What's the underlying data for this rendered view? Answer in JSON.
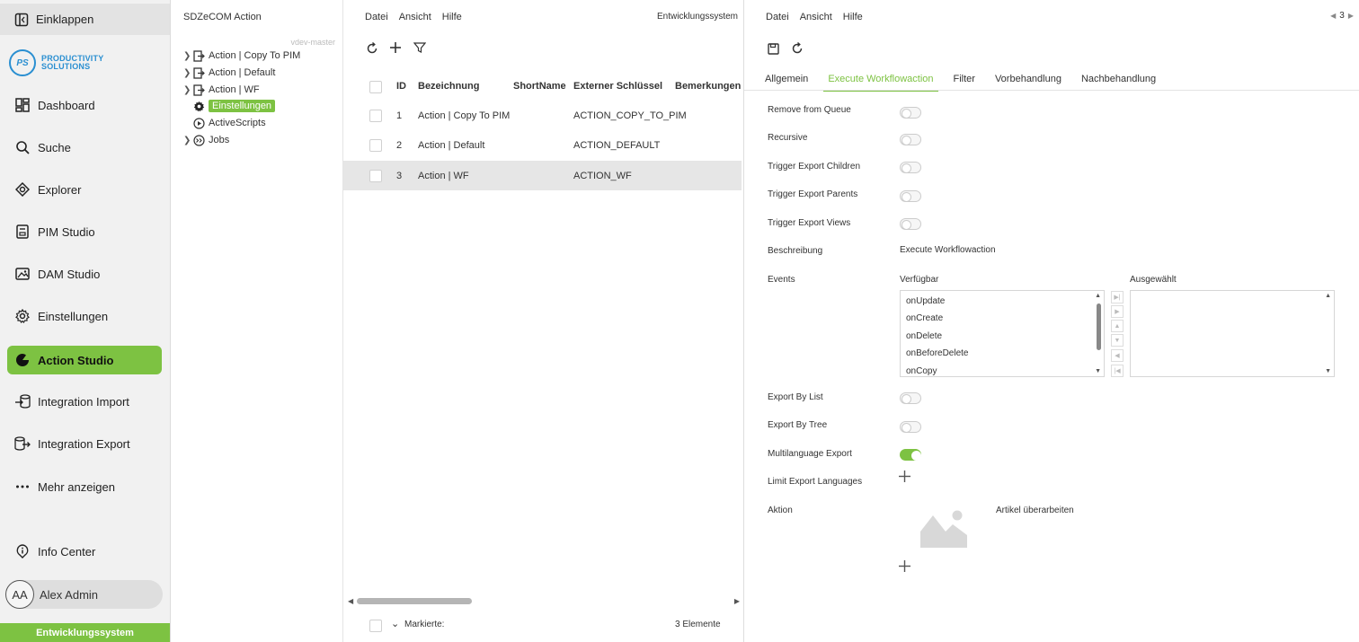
{
  "sidebar": {
    "collapse_label": "Einklappen",
    "logo_text_line1": "PRODUCTIVITY",
    "logo_text_line2": "SOLUTIONS",
    "logo_mark": "PS",
    "items": [
      {
        "label": "Dashboard",
        "icon": "dashboard-icon"
      },
      {
        "label": "Suche",
        "icon": "search-icon"
      },
      {
        "label": "Explorer",
        "icon": "explorer-icon"
      },
      {
        "label": "PIM Studio",
        "icon": "pim-icon"
      },
      {
        "label": "DAM Studio",
        "icon": "image-icon"
      },
      {
        "label": "Einstellungen",
        "icon": "gear-icon"
      },
      {
        "label": "Action Studio",
        "icon": "action-icon"
      },
      {
        "label": "Integration Import",
        "icon": "import-icon"
      },
      {
        "label": "Integration Export",
        "icon": "export-icon"
      },
      {
        "label": "Mehr anzeigen",
        "icon": "more-icon"
      }
    ],
    "info_center": "Info Center",
    "user_initials": "AA",
    "user_name": "Alex Admin",
    "environment": "Entwicklungssystem"
  },
  "tree": {
    "title": "SDZeCOM Action",
    "branch": "vdev-master",
    "nodes": [
      {
        "label": "Action | Copy To PIM"
      },
      {
        "label": "Action | Default"
      },
      {
        "label": "Action | WF"
      },
      {
        "label": "Einstellungen"
      },
      {
        "label": "ActiveScripts"
      },
      {
        "label": "Jobs"
      }
    ]
  },
  "list": {
    "menu": [
      "Datei",
      "Ansicht",
      "Hilfe"
    ],
    "environment": "Entwicklungssystem",
    "columns": [
      "ID",
      "Bezeichnung",
      "ShortName",
      "Externer Schlüssel",
      "Bemerkungen"
    ],
    "rows": [
      {
        "id": "1",
        "name": "Action | Copy To PIM",
        "short": "",
        "key": "ACTION_COPY_TO_PIM"
      },
      {
        "id": "2",
        "name": "Action | Default",
        "short": "",
        "key": "ACTION_DEFAULT"
      },
      {
        "id": "3",
        "name": "Action | WF",
        "short": "",
        "key": "ACTION_WF"
      }
    ],
    "footer_marked": "Markierte:",
    "footer_count": "3 Elemente"
  },
  "detail": {
    "menu": [
      "Datei",
      "Ansicht",
      "Hilfe"
    ],
    "page_number": "3",
    "tabs": [
      "Allgemein",
      "Execute Workflowaction",
      "Filter",
      "Vorbehandlung",
      "Nachbehandlung"
    ],
    "active_tab": 1,
    "fields": {
      "remove_from_queue": "Remove from Queue",
      "recursive": "Recursive",
      "trigger_export_children": "Trigger Export Children",
      "trigger_export_parents": "Trigger Export Parents",
      "trigger_export_views": "Trigger Export Views",
      "beschreibung_label": "Beschreibung",
      "beschreibung_value": "Execute Workflowaction",
      "events_label": "Events",
      "available_label": "Verfügbar",
      "selected_label": "Ausgewählt",
      "events_available": [
        "onUpdate",
        "onCreate",
        "onDelete",
        "onBeforeDelete",
        "onCopy"
      ],
      "export_by_list": "Export By List",
      "export_by_tree": "Export By Tree",
      "multilanguage_export": "Multilanguage Export",
      "limit_export_languages": "Limit Export Languages",
      "aktion_label": "Aktion",
      "aktion_value": "Artikel überarbeiten"
    },
    "toggles": {
      "remove_from_queue": false,
      "recursive": false,
      "trigger_export_children": false,
      "trigger_export_parents": false,
      "trigger_export_views": false,
      "export_by_list": false,
      "export_by_tree": false,
      "multilanguage_export": true
    }
  },
  "colors": {
    "accent": "#7dc242",
    "brand_blue": "#2a8fd1"
  }
}
